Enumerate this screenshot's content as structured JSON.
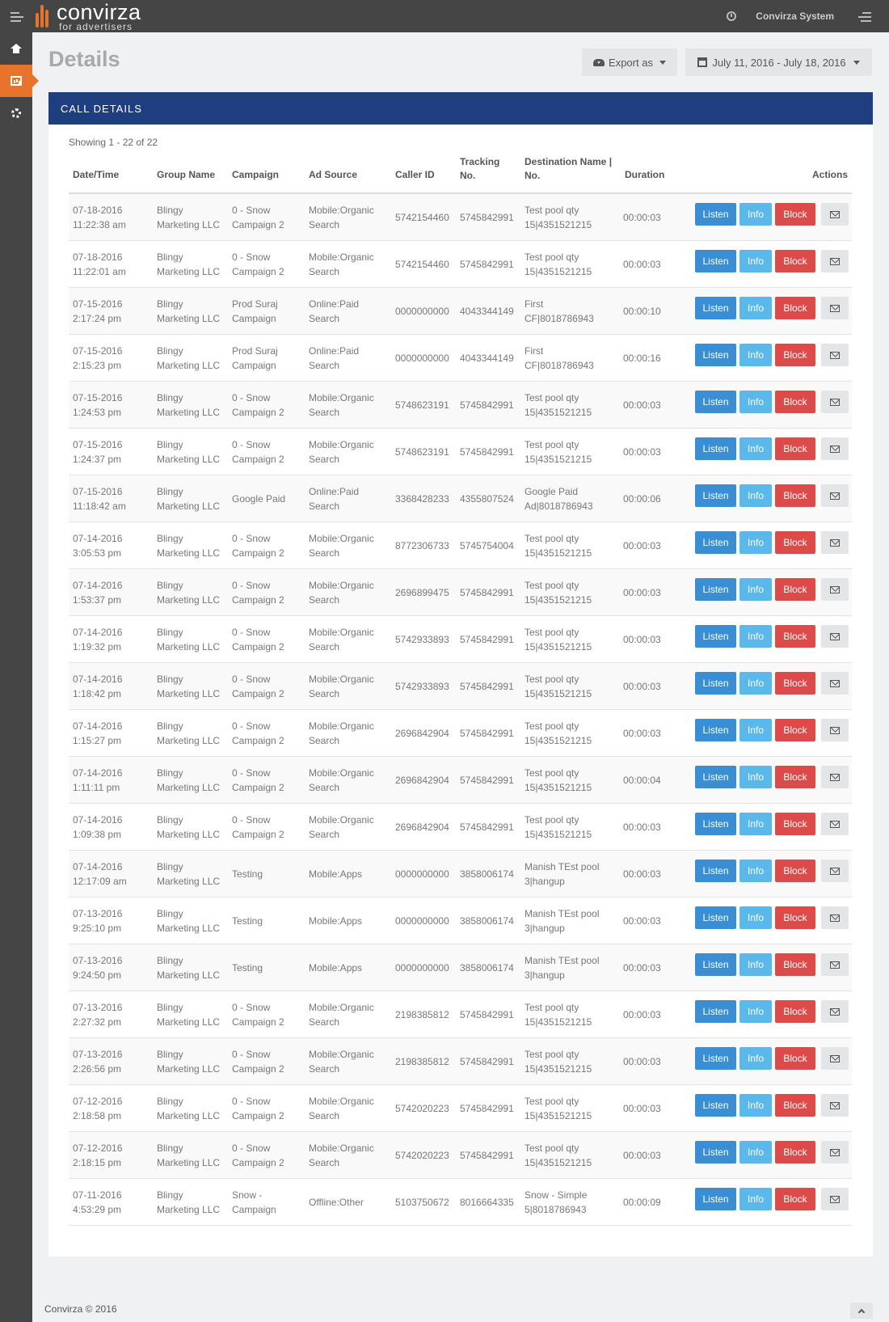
{
  "brand": {
    "name": "convirza",
    "tagline": "for advertisers"
  },
  "topbar": {
    "system_name": "Convirza System"
  },
  "sidebar": {
    "items": [
      {
        "name": "home",
        "icon": "home-icon"
      },
      {
        "name": "reports",
        "icon": "chart-icon",
        "active": true
      },
      {
        "name": "settings",
        "icon": "gear-icon"
      }
    ]
  },
  "page": {
    "title": "Details"
  },
  "toolbar": {
    "export_label": "Export as",
    "date_range": "July 11, 2016 - July 18, 2016"
  },
  "panel": {
    "title": "CALL DETAILS",
    "showing": "Showing 1 - 22 of 22"
  },
  "table": {
    "headers": {
      "datetime": "Date/Time",
      "group": "Group Name",
      "campaign": "Campaign",
      "ad_source": "Ad Source",
      "caller_id": "Caller ID",
      "tracking_1": "Tracking",
      "tracking_2": "No.",
      "dest_1": "Destination Name |",
      "dest_2": "No.",
      "duration": "Duration",
      "actions": "Actions"
    },
    "buttons": {
      "listen": "Listen",
      "info": "Info",
      "block": "Block"
    },
    "rows": [
      [
        "07-18-2016",
        "11:22:38 am",
        "Blingy",
        "Marketing LLC",
        "0 - Snow",
        "Campaign 2",
        "Mobile:Organic",
        "Search",
        "5742154460",
        "5745842991",
        "Test pool qty",
        "15|4351521215",
        "00:00:03"
      ],
      [
        "07-18-2016",
        "11:22:01 am",
        "Blingy",
        "Marketing LLC",
        "0 - Snow",
        "Campaign 2",
        "Mobile:Organic",
        "Search",
        "5742154460",
        "5745842991",
        "Test pool qty",
        "15|4351521215",
        "00:00:03"
      ],
      [
        "07-15-2016",
        "2:17:24 pm",
        "Blingy",
        "Marketing LLC",
        "Prod Suraj",
        "Campaign",
        "Online:Paid",
        "Search",
        "0000000000",
        "4043344149",
        "First",
        "CF|8018786943",
        "00:00:10"
      ],
      [
        "07-15-2016",
        "2:15:23 pm",
        "Blingy",
        "Marketing LLC",
        "Prod Suraj",
        "Campaign",
        "Online:Paid",
        "Search",
        "0000000000",
        "4043344149",
        "First",
        "CF|8018786943",
        "00:00:16"
      ],
      [
        "07-15-2016",
        "1:24:53 pm",
        "Blingy",
        "Marketing LLC",
        "0 - Snow",
        "Campaign 2",
        "Mobile:Organic",
        "Search",
        "5748623191",
        "5745842991",
        "Test pool qty",
        "15|4351521215",
        "00:00:03"
      ],
      [
        "07-15-2016",
        "1:24:37 pm",
        "Blingy",
        "Marketing LLC",
        "0 - Snow",
        "Campaign 2",
        "Mobile:Organic",
        "Search",
        "5748623191",
        "5745842991",
        "Test pool qty",
        "15|4351521215",
        "00:00:03"
      ],
      [
        "07-15-2016",
        "11:18:42 am",
        "Blingy",
        "Marketing LLC",
        "Google Paid",
        "",
        "Online:Paid",
        "Search",
        "3368428233",
        "4355807524",
        "Google Paid",
        "Ad|8018786943",
        "00:00:06"
      ],
      [
        "07-14-2016",
        "3:05:53 pm",
        "Blingy",
        "Marketing LLC",
        "0 - Snow",
        "Campaign 2",
        "Mobile:Organic",
        "Search",
        "8772306733",
        "5745754004",
        "Test pool qty",
        "15|4351521215",
        "00:00:03"
      ],
      [
        "07-14-2016",
        "1:53:37 pm",
        "Blingy",
        "Marketing LLC",
        "0 - Snow",
        "Campaign 2",
        "Mobile:Organic",
        "Search",
        "2696899475",
        "5745842991",
        "Test pool qty",
        "15|4351521215",
        "00:00:03"
      ],
      [
        "07-14-2016",
        "1:19:32 pm",
        "Blingy",
        "Marketing LLC",
        "0 - Snow",
        "Campaign 2",
        "Mobile:Organic",
        "Search",
        "5742933893",
        "5745842991",
        "Test pool qty",
        "15|4351521215",
        "00:00:03"
      ],
      [
        "07-14-2016",
        "1:18:42 pm",
        "Blingy",
        "Marketing LLC",
        "0 - Snow",
        "Campaign 2",
        "Mobile:Organic",
        "Search",
        "5742933893",
        "5745842991",
        "Test pool qty",
        "15|4351521215",
        "00:00:03"
      ],
      [
        "07-14-2016",
        "1:15:27 pm",
        "Blingy",
        "Marketing LLC",
        "0 - Snow",
        "Campaign 2",
        "Mobile:Organic",
        "Search",
        "2696842904",
        "5745842991",
        "Test pool qty",
        "15|4351521215",
        "00:00:03"
      ],
      [
        "07-14-2016",
        "1:11:11 pm",
        "Blingy",
        "Marketing LLC",
        "0 - Snow",
        "Campaign 2",
        "Mobile:Organic",
        "Search",
        "2696842904",
        "5745842991",
        "Test pool qty",
        "15|4351521215",
        "00:00:04"
      ],
      [
        "07-14-2016",
        "1:09:38 pm",
        "Blingy",
        "Marketing LLC",
        "0 - Snow",
        "Campaign 2",
        "Mobile:Organic",
        "Search",
        "2696842904",
        "5745842991",
        "Test pool qty",
        "15|4351521215",
        "00:00:03"
      ],
      [
        "07-14-2016",
        "12:17:09 am",
        "Blingy",
        "Marketing LLC",
        "Testing",
        "",
        "Mobile:Apps",
        "",
        "0000000000",
        "3858006174",
        "Manish TEst pool",
        "3|hangup",
        "00:00:03"
      ],
      [
        "07-13-2016",
        "9:25:10 pm",
        "Blingy",
        "Marketing LLC",
        "Testing",
        "",
        "Mobile:Apps",
        "",
        "0000000000",
        "3858006174",
        "Manish TEst pool",
        "3|hangup",
        "00:00:03"
      ],
      [
        "07-13-2016",
        "9:24:50 pm",
        "Blingy",
        "Marketing LLC",
        "Testing",
        "",
        "Mobile:Apps",
        "",
        "0000000000",
        "3858006174",
        "Manish TEst pool",
        "3|hangup",
        "00:00:03"
      ],
      [
        "07-13-2016",
        "2:27:32 pm",
        "Blingy",
        "Marketing LLC",
        "0 - Snow",
        "Campaign 2",
        "Mobile:Organic",
        "Search",
        "2198385812",
        "5745842991",
        "Test pool qty",
        "15|4351521215",
        "00:00:03"
      ],
      [
        "07-13-2016",
        "2:26:56 pm",
        "Blingy",
        "Marketing LLC",
        "0 - Snow",
        "Campaign 2",
        "Mobile:Organic",
        "Search",
        "2198385812",
        "5745842991",
        "Test pool qty",
        "15|4351521215",
        "00:00:03"
      ],
      [
        "07-12-2016",
        "2:18:58 pm",
        "Blingy",
        "Marketing LLC",
        "0 - Snow",
        "Campaign 2",
        "Mobile:Organic",
        "Search",
        "5742020223",
        "5745842991",
        "Test pool qty",
        "15|4351521215",
        "00:00:03"
      ],
      [
        "07-12-2016",
        "2:18:15 pm",
        "Blingy",
        "Marketing LLC",
        "0 - Snow",
        "Campaign 2",
        "Mobile:Organic",
        "Search",
        "5742020223",
        "5745842991",
        "Test pool qty",
        "15|4351521215",
        "00:00:03"
      ],
      [
        "07-11-2016",
        "4:53:29 pm",
        "Blingy",
        "Marketing LLC",
        "Snow -",
        "Campaign",
        "Offline:Other",
        "",
        "5103750672",
        "8016664335",
        "Snow - Simple",
        "5|8018786943",
        "00:00:09"
      ]
    ]
  },
  "footer": {
    "text": "Convirza © 2016"
  },
  "colors": {
    "brand_orange": "#e8732b",
    "panel_header": "#1f3e80",
    "listen": "#3a8ed4",
    "info": "#5bb8ea",
    "block": "#dc4a4a"
  }
}
